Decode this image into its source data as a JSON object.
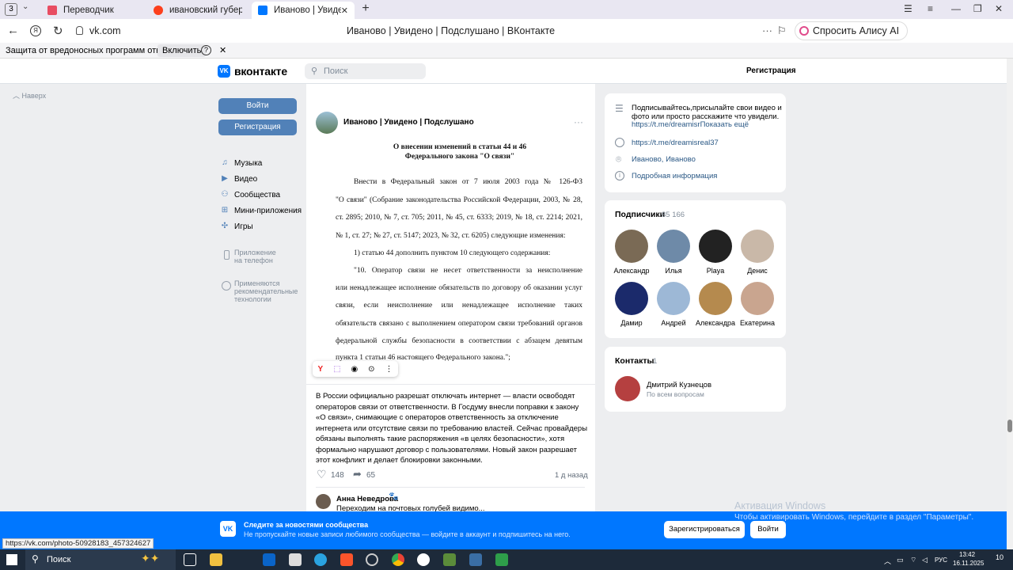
{
  "browser": {
    "tab_count": "3",
    "tabs": [
      {
        "title": "Переводчик",
        "color": "#e84d62"
      },
      {
        "title": "ивановский губернатор р",
        "color": "#f33"
      },
      {
        "title": "Иваново | Увидено | По",
        "color": "#0077ff"
      }
    ],
    "url": "vk.com",
    "page_title": "Иваново | Увидено | Подслушано | ВКонтакте",
    "alice_button": "Спросить Алису AI",
    "protection_text": "Защита от вредоносных программ отключена",
    "protection_button": "Включить"
  },
  "vk": {
    "logo_text": "вконтакте",
    "search_placeholder": "Поиск",
    "register_link": "Регистрация",
    "up_label": "Наверх",
    "login_button": "Войти",
    "register_button": "Регистрация",
    "menu": [
      {
        "label": "Музыка",
        "icon": "music-icon"
      },
      {
        "label": "Видео",
        "icon": "video-icon"
      },
      {
        "label": "Сообщества",
        "icon": "communities-icon"
      },
      {
        "label": "Мини-приложения",
        "icon": "apps-icon"
      },
      {
        "label": "Игры",
        "icon": "games-icon"
      }
    ],
    "app_promo": "Приложение на телефон",
    "app_promo_l1": "Приложение",
    "app_promo_l2": "на телефон",
    "cookies_l1": "Применяются",
    "cookies_l2": "рекомендательные",
    "cookies_l3": "технологии"
  },
  "post": {
    "author": "Иваново | Увидено | Подслушано",
    "doc_title_1": "О внесении изменений в статьи 44 и 46",
    "doc_title_2": "Федерального закона \"О связи\"",
    "doc_lines": [
      "Внести в Федеральный закон от 7 июля 2003 года № 126-ФЗ",
      "\"О связи\" (Собрание законодательства Российской Федерации, 2003, № 28,",
      "ст. 2895; 2010, № 7, ст. 705; 2011, № 45, ст. 6333; 2019, № 18, ст. 2214; 2021,",
      "№ 1, ст. 27; № 27, ст. 5147; 2023, № 32, ст. 6205) следующие изменения:",
      "1) статью 44 дополнить пунктом 10 следующего содержания:",
      "\"10. Оператор связи не несет ответственности за неисполнение",
      "или ненадлежащее исполнение обязательств по договору об оказании услуг",
      "связи, если неисполнение или ненадлежащее исполнение таких",
      "обязательств связано с выполнением оператором связи требований органов",
      "федеральной службы безопасности в соответствии с абзацем девятым",
      "пункта 1 статьи 46 настоящего Федерального закона.\";"
    ],
    "text": "В России официально разрешат отключать интернет — власти освободят операторов связи от ответственности. В Госдуму внесли поправки к закону «О связи», снимающие с операторов ответственность за отключение интернета или отсутствие связи по требованию властей. Сейчас провайдеры обязаны выполнять такие распоряжения «в целях безопасности», хотя формально нарушают договор с пользователями. Новый закон разрешает этот конфликт и делает блокировки законными.",
    "likes": "148",
    "shares": "65",
    "time": "1 д назад",
    "comment_author": "Анна Неведрова",
    "comment_text": "Переходим на почтовых голубей видимо..."
  },
  "sidebar": {
    "description": "Подписывайтесь,присылайте свои видео и фото или просто расскажите что увидели.",
    "desc_l1": "Подписывайтесь,присылайте свои видео и",
    "desc_l2": "фото или просто расскажите что увидели.",
    "desc_link": "https://t.me/dreamisr",
    "show_more": "Показать ещё",
    "website": "https://t.me/dreamisreal37",
    "location": "Иваново, Иваново",
    "more_info": "Подробная информация",
    "subscribers_title": "Подписчики",
    "subscribers_count": "85 166",
    "subscribers": [
      {
        "name": "Александр",
        "color": "#7a6a55"
      },
      {
        "name": "Илья",
        "color": "#6e8aa8"
      },
      {
        "name": "Playa",
        "color": "#222"
      },
      {
        "name": "Денис",
        "color": "#c9b8a8"
      },
      {
        "name": "Дамир",
        "color": "#1b2a6b"
      },
      {
        "name": "Андрей",
        "color": "#9db8d6"
      },
      {
        "name": "Александра",
        "color": "#b58a4e"
      },
      {
        "name": "Екатерина",
        "color": "#c9a58f"
      }
    ],
    "contacts_title": "Контакты",
    "contacts_count": "1",
    "contact_name": "Дмитрий Кузнецов",
    "contact_role": "По всем вопросам"
  },
  "banner": {
    "title": "Следите за новостями сообщества",
    "subtitle": "Не пропускайте новые записи любимого сообщества — войдите в аккаунт и подпишитесь на него.",
    "register_button": "Зарегистрироваться",
    "login_button": "Войти"
  },
  "status_url": "https://vk.com/photo-50928183_457324627",
  "watermark_title": "Активация Windows",
  "watermark_text": "Чтобы активировать Windows, перейдите в раздел \"Параметры\".",
  "taskbar": {
    "search": "Поиск",
    "lang": "РУС",
    "time": "13:42",
    "date": "16.11.2025",
    "notifications": "10"
  }
}
